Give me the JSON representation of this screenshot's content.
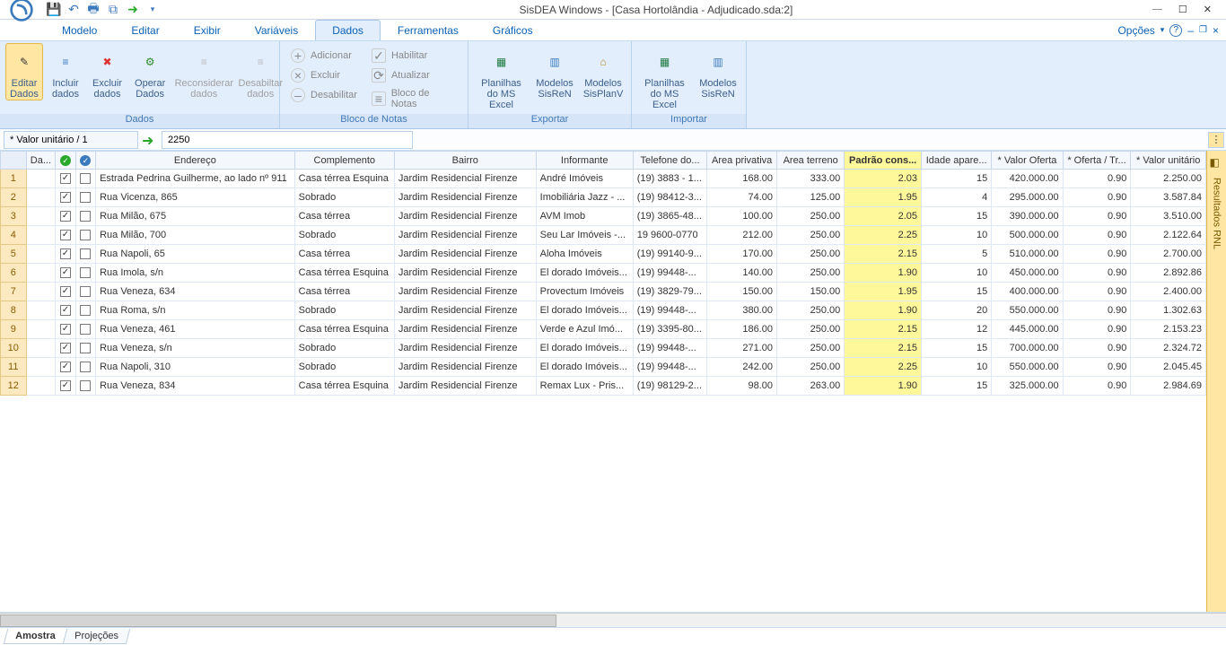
{
  "title": "SisDEA Windows - [Casa Hortolândia - Adjudicado.sda:2]",
  "menu": {
    "opcoes": "Opções",
    "tabs": [
      "Modelo",
      "Editar",
      "Exibir",
      "Variáveis",
      "Dados",
      "Ferramentas",
      "Gráficos"
    ],
    "active": 4
  },
  "ribbon": {
    "g1": {
      "label": "Dados",
      "editar": "Editar\nDados",
      "incluir": "Incluir\ndados",
      "excluir": "Excluir\ndados",
      "operar": "Operar\nDados",
      "reconsid": "Reconsiderar\ndados",
      "desab": "Desabiltar\ndados"
    },
    "g2": {
      "label": "Bloco de Notas",
      "adicionar": "Adicionar",
      "habilitar": "Habilitar",
      "excluir": "Excluir",
      "atualizar": "Atualizar",
      "desabilitar": "Desabilitar",
      "bloco": "Bloco de Notas"
    },
    "g3": {
      "label": "Exportar",
      "excel": "Planilhas\ndo MS Excel",
      "sisren": "Modelos\nSisReN",
      "sisplanv": "Modelos\nSisPlanV"
    },
    "g4": {
      "label": "Importar",
      "excel": "Planilhas\ndo MS Excel",
      "sisren": "Modelos\nSisReN"
    }
  },
  "formula": {
    "ref": "* Valor unitário / 1",
    "value": "2250"
  },
  "sidebarLabel": "Resultados RNL",
  "cols": {
    "dado": "Da...",
    "endereco": "Endereço",
    "complemento": "Complemento",
    "bairro": "Bairro",
    "informante": "Informante",
    "telefone": "Telefone do...",
    "areapriv": "Area privativa",
    "areater": "Area terreno",
    "padrao": "Padrão cons...",
    "idade": "Idade apare...",
    "oferta": "* Valor Oferta",
    "ofertatr": "* Oferta / Tr...",
    "unit": "* Valor unitário"
  },
  "rows": [
    {
      "n": "1",
      "end": "Estrada Pedrina Guilherme, ao lado nº 911",
      "comp": "Casa térrea Esquina",
      "bai": "Jardim Residencial Firenze",
      "inf": "André Imóveis",
      "tel": "(19) 3883 - 1...",
      "ap": "168.00",
      "at": "333.00",
      "pc": "2.03",
      "id": "15",
      "vo": "420.000.00",
      "ot": "0.90",
      "vu": "2.250.00"
    },
    {
      "n": "2",
      "end": "Rua Vicenza, 865",
      "comp": "Sobrado",
      "bai": "Jardim Residencial Firenze",
      "inf": "Imobiliária Jazz - ...",
      "tel": "(19) 98412-3...",
      "ap": "74.00",
      "at": "125.00",
      "pc": "1.95",
      "id": "4",
      "vo": "295.000.00",
      "ot": "0.90",
      "vu": "3.587.84"
    },
    {
      "n": "3",
      "end": "Rua Milão, 675",
      "comp": "Casa térrea",
      "bai": "Jardim Residencial Firenze",
      "inf": "AVM Imob",
      "tel": "(19) 3865-48...",
      "ap": "100.00",
      "at": "250.00",
      "pc": "2.05",
      "id": "15",
      "vo": "390.000.00",
      "ot": "0.90",
      "vu": "3.510.00"
    },
    {
      "n": "4",
      "end": "Rua Milão, 700",
      "comp": "Sobrado",
      "bai": "Jardim Residencial Firenze",
      "inf": "Seu Lar Imóveis -...",
      "tel": "19 9600-0770",
      "ap": "212.00",
      "at": "250.00",
      "pc": "2.25",
      "id": "10",
      "vo": "500.000.00",
      "ot": "0.90",
      "vu": "2.122.64"
    },
    {
      "n": "5",
      "end": "Rua Napoli, 65",
      "comp": "Casa térrea",
      "bai": "Jardim Residencial Firenze",
      "inf": "Aloha Imóveis",
      "tel": "(19) 99140-9...",
      "ap": "170.00",
      "at": "250.00",
      "pc": "2.15",
      "id": "5",
      "vo": "510.000.00",
      "ot": "0.90",
      "vu": "2.700.00"
    },
    {
      "n": "6",
      "end": "Rua Imola, s/n",
      "comp": "Casa térrea Esquina",
      "bai": "Jardim Residencial Firenze",
      "inf": "El dorado Imóveis...",
      "tel": "(19) 99448-...",
      "ap": "140.00",
      "at": "250.00",
      "pc": "1.90",
      "id": "10",
      "vo": "450.000.00",
      "ot": "0.90",
      "vu": "2.892.86"
    },
    {
      "n": "7",
      "end": "Rua Veneza, 634",
      "comp": "Casa térrea",
      "bai": "Jardim Residencial Firenze",
      "inf": "Provectum Imóveis",
      "tel": "(19) 3829-79...",
      "ap": "150.00",
      "at": "150.00",
      "pc": "1.95",
      "id": "15",
      "vo": "400.000.00",
      "ot": "0.90",
      "vu": "2.400.00"
    },
    {
      "n": "8",
      "end": "Rua Roma, s/n",
      "comp": "Sobrado",
      "bai": "Jardim Residencial Firenze",
      "inf": "El dorado Imóveis...",
      "tel": "(19) 99448-...",
      "ap": "380.00",
      "at": "250.00",
      "pc": "1.90",
      "id": "20",
      "vo": "550.000.00",
      "ot": "0.90",
      "vu": "1.302.63"
    },
    {
      "n": "9",
      "end": "Rua Veneza, 461",
      "comp": "Casa térrea Esquina",
      "bai": "Jardim Residencial Firenze",
      "inf": "Verde e Azul Imó...",
      "tel": "(19) 3395-80...",
      "ap": "186.00",
      "at": "250.00",
      "pc": "2.15",
      "id": "12",
      "vo": "445.000.00",
      "ot": "0.90",
      "vu": "2.153.23"
    },
    {
      "n": "10",
      "end": "Rua Veneza, s/n",
      "comp": "Sobrado",
      "bai": "Jardim Residencial Firenze",
      "inf": "El dorado Imóveis...",
      "tel": "(19) 99448-...",
      "ap": "271.00",
      "at": "250.00",
      "pc": "2.15",
      "id": "15",
      "vo": "700.000.00",
      "ot": "0.90",
      "vu": "2.324.72"
    },
    {
      "n": "11",
      "end": "Rua Napoli, 310",
      "comp": "Sobrado",
      "bai": "Jardim Residencial Firenze",
      "inf": "El dorado Imóveis...",
      "tel": "(19) 99448-...",
      "ap": "242.00",
      "at": "250.00",
      "pc": "2.25",
      "id": "10",
      "vo": "550.000.00",
      "ot": "0.90",
      "vu": "2.045.45"
    },
    {
      "n": "12",
      "end": "Rua Veneza, 834",
      "comp": "Casa térrea Esquina",
      "bai": "Jardim Residencial Firenze",
      "inf": "Remax Lux - Pris...",
      "tel": "(19) 98129-2...",
      "ap": "98.00",
      "at": "263.00",
      "pc": "1.90",
      "id": "15",
      "vo": "325.000.00",
      "ot": "0.90",
      "vu": "2.984.69"
    }
  ],
  "sheets": {
    "amostra": "Amostra",
    "proj": "Projeções"
  }
}
